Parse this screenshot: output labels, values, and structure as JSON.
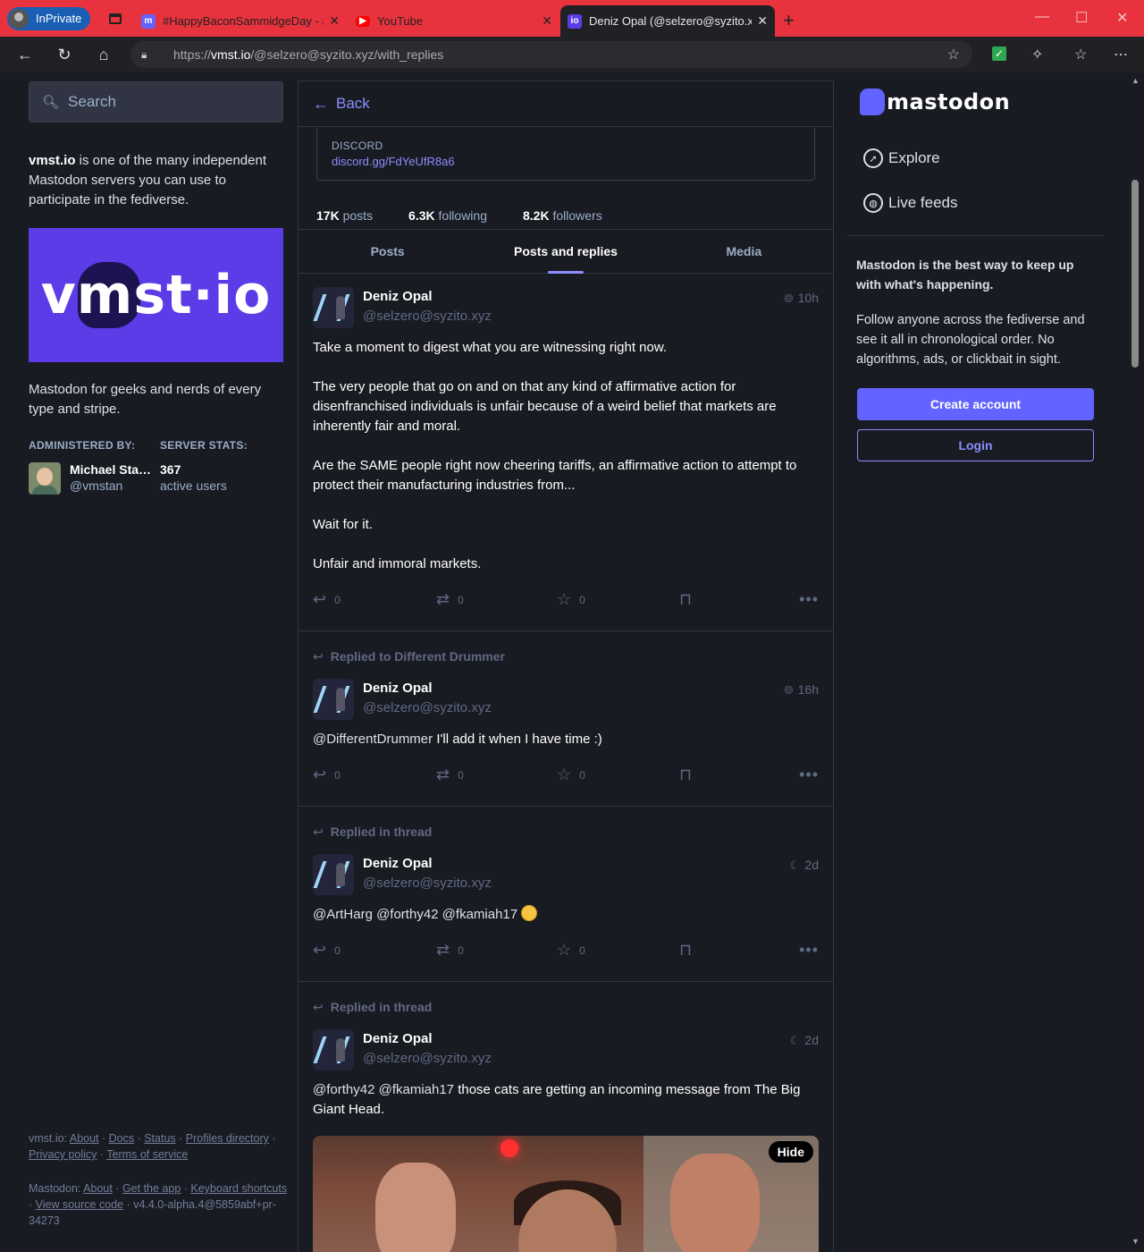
{
  "browser": {
    "inprivate_label": "InPrivate",
    "tabs": [
      {
        "title": "#HappyBaconSammidgeDay - #M",
        "favicon": "mastodon-icon"
      },
      {
        "title": "YouTube",
        "favicon": "youtube-icon"
      },
      {
        "title": "Deniz Opal (@selzero@syzito.xyz)",
        "favicon": "vmst-icon"
      }
    ],
    "url_prefix": "https://",
    "url_host": "vmst.io",
    "url_path": "/@selzero@syzito.xyz/with_replies"
  },
  "left": {
    "search_placeholder": "Search",
    "about_domain": "vmst.io",
    "about_text": " is one of the many independent Mastodon servers you can use to participate in the fediverse.",
    "banner_text": "vmst·io",
    "description": "Mastodon for geeks and nerds of every type and stripe.",
    "administered_by_label": "ADMINISTERED BY:",
    "server_stats_label": "SERVER STATS:",
    "admin_name": "Michael Stanclift",
    "admin_acct": "@vmstan",
    "active_users_num": "367",
    "active_users_label": "active users",
    "footer1": {
      "domain": "vmst.io:",
      "links": [
        "About",
        "Docs",
        "Status",
        "Profiles directory",
        "Privacy policy",
        "Terms of service"
      ]
    },
    "footer2": {
      "label": "Mastodon:",
      "links": [
        "About",
        "Get the app",
        "Keyboard shortcuts",
        "View source code"
      ],
      "version": "v4.4.0-alpha.4@5859abf+pr-34273"
    }
  },
  "profile": {
    "back_label": "Back",
    "field_name": "DISCORD",
    "field_value": "discord.gg/FdYeUfR8a6",
    "posts_count": "17K",
    "posts_label": "posts",
    "following_count": "6.3K",
    "following_label": "following",
    "followers_count": "8.2K",
    "followers_label": "followers",
    "tabs": [
      "Posts",
      "Posts and replies",
      "Media"
    ],
    "active_tab": "Posts and replies"
  },
  "statuses": [
    {
      "name": "Deniz Opal",
      "acct": "@selzero@syzito.xyz",
      "time": "10h",
      "visibility_icon": "globe-icon",
      "paragraphs": [
        "Take a moment to digest what you are witnessing right now.",
        "The very people that go on and on that any kind of affirmative action for disenfranchised individuals is unfair because of a weird belief that markets are inherently fair and moral.",
        "Are the SAME people right now cheering tariffs, an affirmative action to attempt to protect their manufacturing industries from...",
        "Wait for it.",
        "Unfair and immoral markets."
      ],
      "replies": "0",
      "boosts": "0",
      "favourites": "0"
    },
    {
      "prepend": "Replied to Different Drummer",
      "name": "Deniz Opal",
      "acct": "@selzero@syzito.xyz",
      "time": "16h",
      "visibility_icon": "globe-icon",
      "mention": "@DifferentDrummer",
      "text": " I'll add it when I have time :)",
      "replies": "0",
      "boosts": "0",
      "favourites": "0"
    },
    {
      "prepend": "Replied in thread",
      "name": "Deniz Opal",
      "acct": "@selzero@syzito.xyz",
      "time": "2d",
      "visibility_icon": "moon-icon",
      "mention": "@ArtHarg @forthy42 @fkamiah17",
      "text": " ",
      "replies": "0",
      "boosts": "0",
      "favourites": "0"
    },
    {
      "prepend": "Replied in thread",
      "name": "Deniz Opal",
      "acct": "@selzero@syzito.xyz",
      "time": "2d",
      "visibility_icon": "moon-icon",
      "mention": "@forthy42 @fkamiah17",
      "text": " those cats are getting an incoming message from The Big Giant Head.",
      "hide_label": "Hide"
    }
  ],
  "right": {
    "logo_text": "mastodon",
    "nav": [
      "Explore",
      "Live feeds"
    ],
    "heading": "Mastodon is the best way to keep up with what's happening.",
    "text": "Follow anyone across the fediverse and see it all in chronological order. No algorithms, ads, or clickbait in sight.",
    "create_account": "Create account",
    "login": "Login"
  },
  "colors": {
    "accent": "#6364ff",
    "link": "#8c8dff",
    "bg": "#191b22",
    "browser_frame": "#e8333e"
  }
}
